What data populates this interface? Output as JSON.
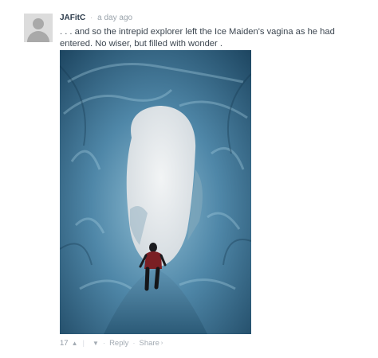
{
  "comment": {
    "author": "JAFitC",
    "separator": "·",
    "timestamp": "a day ago",
    "text": ". . . and so the intrepid explorer left the Ice Maiden's vagina as he had entered. No wiser, but filled with wonder .",
    "image": {
      "subject": "ice-cave-photo",
      "colors": {
        "ice_dark": "#1f4a66",
        "ice_mid": "#4f87a8",
        "ice_light": "#9cc4d8",
        "sky": "#e4e8ea"
      }
    }
  },
  "actions": {
    "vote_count": "17",
    "upvote_icon": "▲",
    "downvote_icon": "▼",
    "divider": "|",
    "dot": "·",
    "reply_label": "Reply",
    "share_label": "Share",
    "share_caret": "›"
  }
}
